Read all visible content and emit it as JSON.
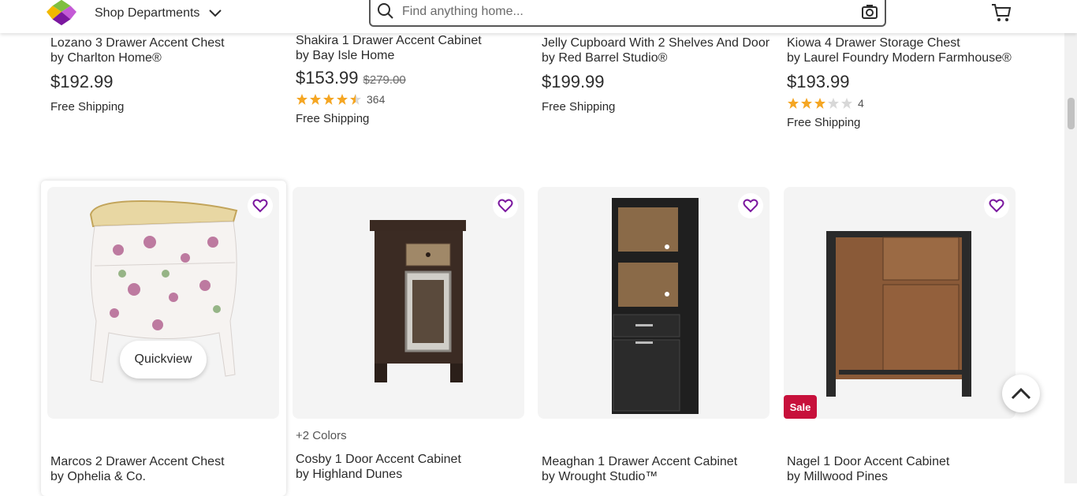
{
  "header": {
    "departments_label": "Shop Departments",
    "search_placeholder": "Find anything home..."
  },
  "top_products": [
    {
      "title": "Lozano 3 Drawer Accent Chest",
      "brand": "by Charlton Home®",
      "price": "$192.99",
      "old_price": "",
      "rating": null,
      "reviews": "",
      "shipping": "Free Shipping"
    },
    {
      "title": "Shakira 1 Drawer Accent Cabinet",
      "brand": "by Bay Isle Home",
      "price": "$153.99",
      "old_price": "$279.00",
      "rating": 4.5,
      "reviews": "364",
      "shipping": "Free Shipping"
    },
    {
      "title": "Jelly Cupboard With 2 Shelves And Door",
      "brand": "by Red Barrel Studio®",
      "price": "$199.99",
      "old_price": "",
      "rating": null,
      "reviews": "",
      "shipping": "Free Shipping"
    },
    {
      "title": "Kiowa 4 Drawer Storage Chest",
      "brand": "by Laurel Foundry Modern Farmhouse®",
      "price": "$193.99",
      "old_price": "",
      "rating": 3,
      "reviews": "4",
      "shipping": "Free Shipping"
    }
  ],
  "bottom_products": [
    {
      "title": "Marcos 2 Drawer Accent Chest",
      "brand": "by Ophelia & Co."
    },
    {
      "title": "Cosby 1 Door Accent Cabinet",
      "brand": "by Highland Dunes"
    },
    {
      "title": "Meaghan 1 Drawer Accent Cabinet",
      "brand": "by Wrought Studio™"
    },
    {
      "title": "Nagel 1 Door Accent Cabinet",
      "brand": "by Millwood Pines"
    }
  ],
  "quickview_label": "Quickview",
  "colors_label": "+2 Colors",
  "sale_label": "Sale",
  "colors": {
    "accent": "#7b189f",
    "sale": "#c7103b",
    "star": "#f5a623"
  }
}
